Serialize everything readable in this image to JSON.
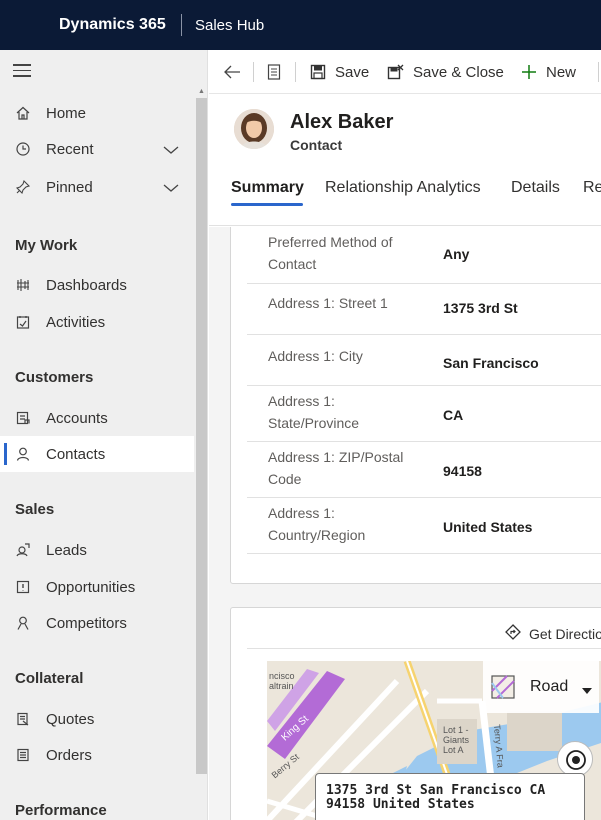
{
  "topbar": {
    "app_name": "Dynamics 365",
    "hub_name": "Sales Hub"
  },
  "sidebar": {
    "items_top": [
      {
        "label": "Home",
        "icon": "home-icon"
      },
      {
        "label": "Recent",
        "icon": "clock-icon",
        "expandable": true
      },
      {
        "label": "Pinned",
        "icon": "pin-icon",
        "expandable": true
      }
    ],
    "sections": [
      {
        "title": "My Work",
        "items": [
          {
            "label": "Dashboards",
            "icon": "dashboard-icon"
          },
          {
            "label": "Activities",
            "icon": "activities-icon"
          }
        ]
      },
      {
        "title": "Customers",
        "items": [
          {
            "label": "Accounts",
            "icon": "accounts-icon"
          },
          {
            "label": "Contacts",
            "icon": "person-icon",
            "active": true
          }
        ]
      },
      {
        "title": "Sales",
        "items": [
          {
            "label": "Leads",
            "icon": "leads-icon"
          },
          {
            "label": "Opportunities",
            "icon": "opportunities-icon"
          },
          {
            "label": "Competitors",
            "icon": "competitors-icon"
          }
        ]
      },
      {
        "title": "Collateral",
        "items": [
          {
            "label": "Quotes",
            "icon": "quotes-icon"
          },
          {
            "label": "Orders",
            "icon": "orders-icon"
          }
        ]
      },
      {
        "title": "Performance",
        "items": []
      }
    ]
  },
  "commandbar": {
    "save_label": "Save",
    "save_close_label": "Save & Close",
    "new_label": "New"
  },
  "record": {
    "name": "Alex Baker",
    "entity": "Contact",
    "tabs": [
      "Summary",
      "Relationship Analytics",
      "Details",
      "Re"
    ],
    "active_tab": "Summary"
  },
  "fields": [
    {
      "label": "Preferred Method of Contact",
      "value": "Any"
    },
    {
      "label": "Address 1: Street 1",
      "value": "1375 3rd St"
    },
    {
      "label": "Address 1: City",
      "value": "San Francisco"
    },
    {
      "label": "Address 1: State/Province",
      "value": "CA"
    },
    {
      "label": "Address 1: ZIP/Postal Code",
      "value": "94158"
    },
    {
      "label": "Address 1: Country/Region",
      "value": "United States"
    }
  ],
  "map": {
    "get_directions_label": "Get Directio",
    "view_mode": "Road",
    "address_line1": "1375 3rd St San Francisco CA",
    "address_line2": "94158 United States",
    "labels": {
      "caltrain": "ncisco\naltrain",
      "street1": "King St",
      "street2": "Berry St",
      "lot": "Lot 1 -\nGiants\nLot A",
      "street3": "Terry A Fra"
    }
  },
  "colors": {
    "topbar": "#0b1a36",
    "accent": "#2a66cc",
    "sidebar_bg": "#efefef",
    "content_bg": "#f4f4f4"
  }
}
